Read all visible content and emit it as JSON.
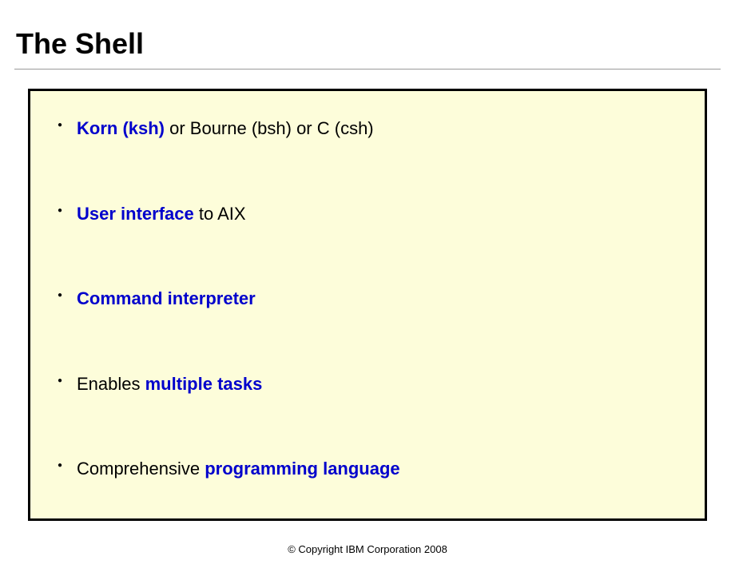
{
  "title": "The Shell",
  "bullets": [
    {
      "segments": [
        {
          "text": "Korn (ksh)",
          "highlight": true
        },
        {
          "text": " or Bourne (bsh) or C (csh)",
          "highlight": false
        }
      ]
    },
    {
      "segments": [
        {
          "text": "User interface",
          "highlight": true
        },
        {
          "text": " to AIX",
          "highlight": false
        }
      ]
    },
    {
      "segments": [
        {
          "text": "Command interpreter",
          "highlight": true
        }
      ]
    },
    {
      "segments": [
        {
          "text": "Enables ",
          "highlight": false
        },
        {
          "text": "multiple tasks",
          "highlight": true
        }
      ]
    },
    {
      "segments": [
        {
          "text": "Comprehensive ",
          "highlight": false
        },
        {
          "text": "programming language",
          "highlight": true
        }
      ]
    }
  ],
  "copyright": "© Copyright IBM Corporation 2008"
}
